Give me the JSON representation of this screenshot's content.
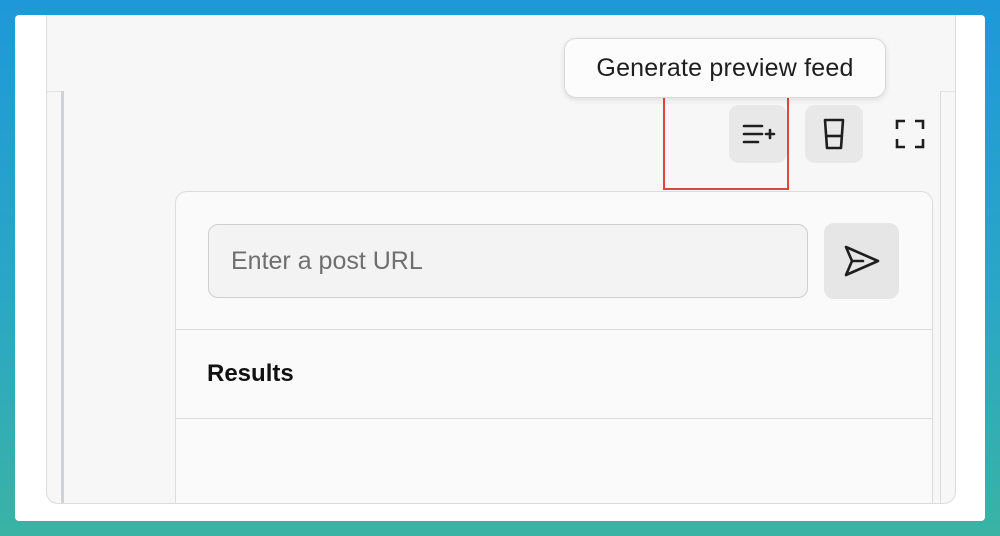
{
  "tooltip": {
    "text": "Generate preview feed"
  },
  "toolbar": {
    "buttons": [
      {
        "icon": "list-add-icon"
      },
      {
        "icon": "cup-icon"
      },
      {
        "icon": "fullscreen-icon"
      }
    ]
  },
  "url_input": {
    "placeholder": "Enter a post URL",
    "value": ""
  },
  "send_button": {
    "icon": "send-icon"
  },
  "results": {
    "title": "Results"
  },
  "colors": {
    "highlight": "#e0463a",
    "background_top": "#1f98d9",
    "background_bottom": "#3ab3a4"
  }
}
